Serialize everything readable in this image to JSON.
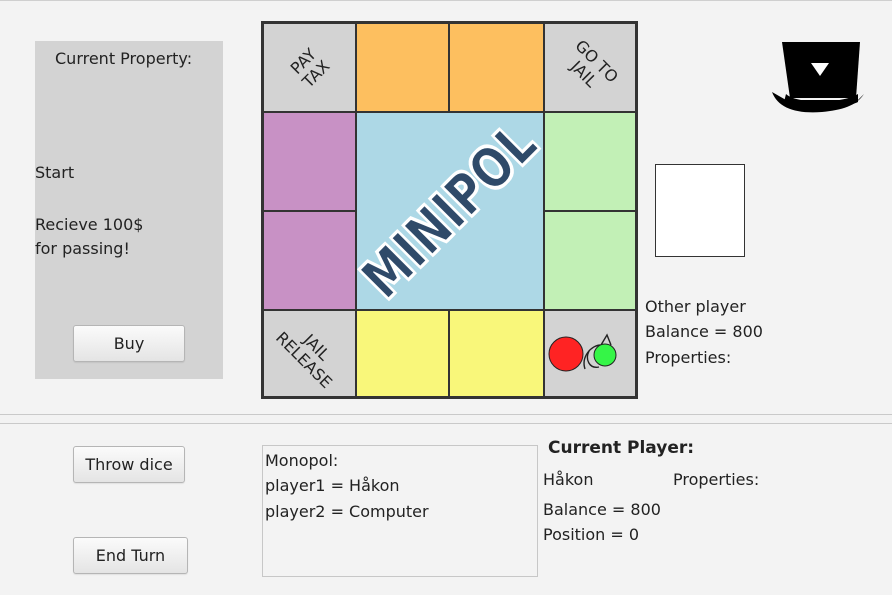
{
  "property_panel": {
    "title": "Current Property:",
    "name": "Start",
    "description_lines": [
      "Recieve 100$",
      "for passing!"
    ],
    "buy_label": "Buy"
  },
  "board": {
    "center_logo": "MINIPOL",
    "corners": {
      "top_left": [
        "PAY",
        "TAX"
      ],
      "top_right": [
        "GO TO",
        "JAIL"
      ],
      "bottom_left": [
        "JAIL",
        "RELEASE"
      ]
    },
    "colors": {
      "orange": "#fdbf5f",
      "purple": "#c891c5",
      "green": "#c2f0b6",
      "yellow": "#f9f77a",
      "center": "#add8e6",
      "corner": "#d3d3d3"
    },
    "tokens": [
      {
        "color": "#ff2323",
        "cell": "start"
      },
      {
        "color": "#35f547",
        "cell": "start"
      }
    ]
  },
  "other_player": {
    "title": "Other player",
    "balance": "Balance = 800",
    "properties": "Properties:"
  },
  "controls": {
    "throw_dice_label": "Throw dice",
    "end_turn_label": "End Turn"
  },
  "log": {
    "lines": [
      "Monopol:",
      "player1 = Håkon",
      "player2 = Computer"
    ]
  },
  "current_player": {
    "title": "Current Player:",
    "name": "Håkon",
    "properties": "Properties:",
    "balance": "Balance = 800",
    "position": "Position = 0"
  },
  "icons": {
    "hat": "top-hat-icon",
    "start_arrow": "start-arrow-icon"
  }
}
